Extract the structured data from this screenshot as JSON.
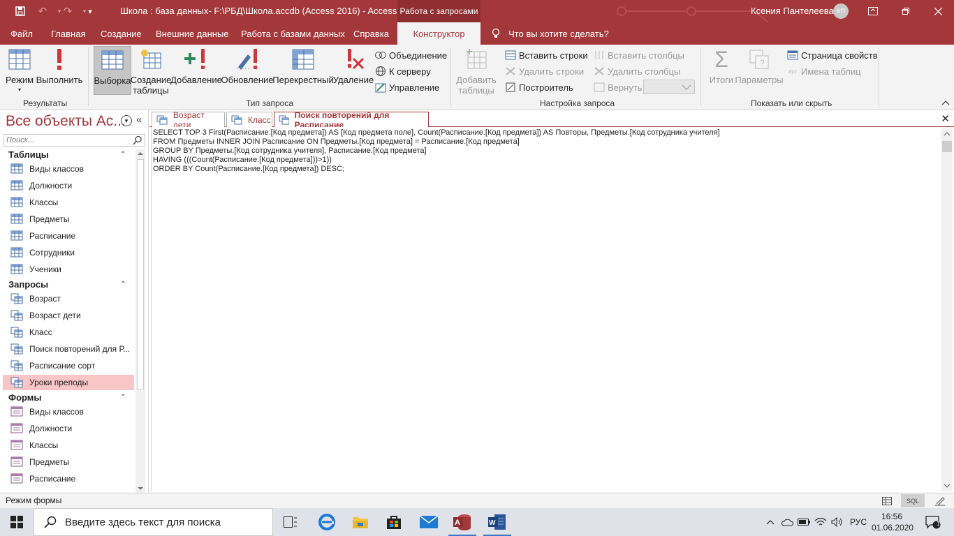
{
  "titlebar": {
    "title": "Школа : база данных- F:\\РБД\\Школа.accdb (Access 2016)  -  Access",
    "context_tab": "Работа с запросами",
    "user_name": "Ксения Пантелеева",
    "user_initials": "КП"
  },
  "ribbon_tabs": [
    "Файл",
    "Главная",
    "Создание",
    "Внешние данные",
    "Работа с базами данных",
    "Справка",
    "Конструктор"
  ],
  "active_tab": "Конструктор",
  "tell_me": "Что вы хотите сделать?",
  "ribbon": {
    "results": {
      "label": "Результаты",
      "mode": "Режим",
      "run": "Выполнить"
    },
    "query_type": {
      "label": "Тип запроса",
      "select": "Выборка",
      "make_table_1": "Создание",
      "make_table_2": "таблицы",
      "append": "Добавление",
      "update": "Обновление",
      "crosstab": "Перекрестный",
      "delete": "Удаление",
      "union": "Объединение",
      "passthrough": "К серверу",
      "data_definition": "Управление"
    },
    "query_setup": {
      "label": "Настройка запроса",
      "show_table_1": "Добавить",
      "show_table_2": "таблицы",
      "insert_rows": "Вставить строки",
      "delete_rows": "Удалить строки",
      "builder": "Построитель",
      "insert_columns": "Вставить столбцы",
      "delete_columns": "Удалить столбцы",
      "return": "Вернуть:"
    },
    "show_hide": {
      "label": "Показать или скрыть",
      "totals": "Итоги",
      "parameters": "Параметры",
      "property_sheet": "Страница свойств",
      "table_names": "Имена таблиц"
    }
  },
  "nav": {
    "title": "Все объекты Ac...",
    "search_placeholder": "Поиск...",
    "groups": {
      "tables": {
        "title": "Таблицы",
        "items": [
          "Виды классов",
          "Должности",
          "Классы",
          "Предметы",
          "Расписание",
          "Сотрудники",
          "Ученики"
        ]
      },
      "queries": {
        "title": "Запросы",
        "items": [
          "Возраст",
          "Возраст дети",
          "Класс",
          "Поиск повторений для Р...",
          "Расписание сорт",
          "Уроки преподы"
        ]
      },
      "forms": {
        "title": "Формы",
        "items": [
          "Виды классов",
          "Должности",
          "Классы",
          "Предметы",
          "Расписание"
        ]
      }
    },
    "highlighted_item": "Уроки преподы"
  },
  "doc_tabs": [
    "Возраст дети",
    "Класс",
    "Поиск повторений для Расписание"
  ],
  "active_doc_tab": "Поиск повторений для Расписание",
  "sql_lines": [
    "SELECT TOP 3 First(Расписание.[Код предмета]) AS [Код предмета поле], Count(Расписание.[Код предмета]) AS Повторы, Предметы.[Код сотрудника учителя]",
    "FROM Предметы INNER JOIN Расписание ON Предметы.[Код предмета] = Расписание.[Код предмета]",
    "GROUP BY Предметы.[Код сотрудника учителя], Расписание.[Код предмета]",
    "HAVING (((Count(Расписание.[Код предмета]))>1))",
    "ORDER BY Count(Расписание.[Код предмета]) DESC;"
  ],
  "status": {
    "text": "Режим формы",
    "sql_view": "SQL"
  },
  "taskbar": {
    "search_placeholder": "Введите здесь текст для поиска",
    "language": "РУС",
    "time": "16:56",
    "date": "01.06.2020",
    "notifications": "1"
  },
  "colors": {
    "accent": "#a4373a",
    "highlight": "#f9c5c6"
  }
}
